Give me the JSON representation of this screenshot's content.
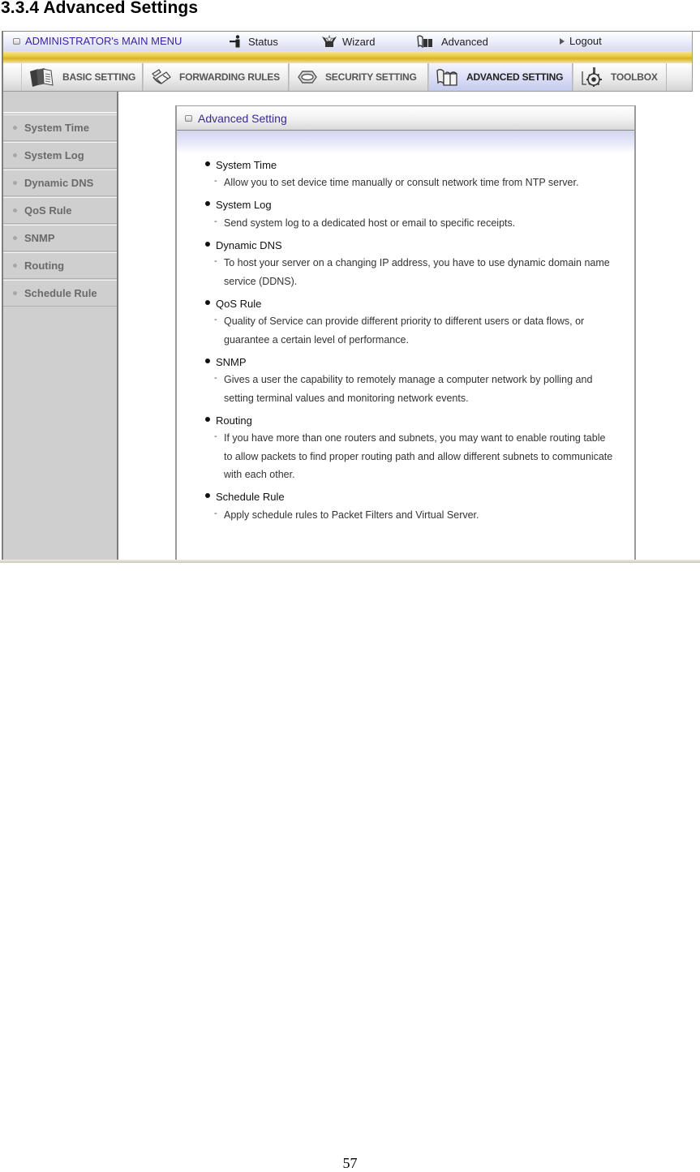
{
  "document": {
    "heading": "3.3.4 Advanced Settings",
    "page_number": "57"
  },
  "main_menu": {
    "title": "ADMINISTRATOR's MAIN MENU",
    "items": [
      {
        "label": "Status",
        "icon": "status-person-icon"
      },
      {
        "label": "Wizard",
        "icon": "wizard-icon"
      },
      {
        "label": "Advanced",
        "icon": "advanced-book-icon"
      },
      {
        "label": "Logout",
        "icon": "triangle-right-icon"
      }
    ]
  },
  "tabs": [
    {
      "label": "BASIC SETTING",
      "icon": "folder-documents-icon",
      "active": false
    },
    {
      "label": "FORWARDING RULES",
      "icon": "forwarding-icon",
      "active": false
    },
    {
      "label": "SECURITY SETTING",
      "icon": "nut-icon",
      "active": false
    },
    {
      "label": "ADVANCED SETTING",
      "icon": "advanced-book-icon",
      "active": true
    },
    {
      "label": "TOOLBOX",
      "icon": "gear-toolbox-icon",
      "active": false
    }
  ],
  "sidebar": {
    "items": [
      {
        "label": "System Time"
      },
      {
        "label": "System Log"
      },
      {
        "label": "Dynamic DNS"
      },
      {
        "label": "QoS Rule"
      },
      {
        "label": "SNMP"
      },
      {
        "label": "Routing"
      },
      {
        "label": "Schedule Rule"
      }
    ]
  },
  "panel": {
    "title": "Advanced Setting",
    "entries": [
      {
        "title": "System Time",
        "desc": "Allow you to set device time manually or consult network time from NTP server."
      },
      {
        "title": "System Log",
        "desc": "Send system log to a dedicated host or email to specific receipts."
      },
      {
        "title": "Dynamic DNS",
        "desc": "To host your server on a changing IP address, you have to use dynamic domain name service (DDNS)."
      },
      {
        "title": "QoS Rule",
        "desc": "Quality of Service can provide different priority to different users or data flows, or guarantee a certain level of performance."
      },
      {
        "title": "SNMP",
        "desc": "Gives a user the capability to remotely manage a computer network by polling and setting terminal values and monitoring network events."
      },
      {
        "title": "Routing",
        "desc": "If you have more than one routers and subnets, you may want to enable routing table to allow packets to find proper routing path and allow different subnets to communicate with each other."
      },
      {
        "title": "Schedule Rule",
        "desc": "Apply schedule rules to Packet Filters and Virtual Server."
      }
    ]
  },
  "colors": {
    "menu_title": "#3a1fa0",
    "panel_title": "#3a2a8e",
    "gold_bar": "#e8c83a",
    "sidebar_bg": "#cfcfcf",
    "active_tab": "#c5cbee"
  }
}
